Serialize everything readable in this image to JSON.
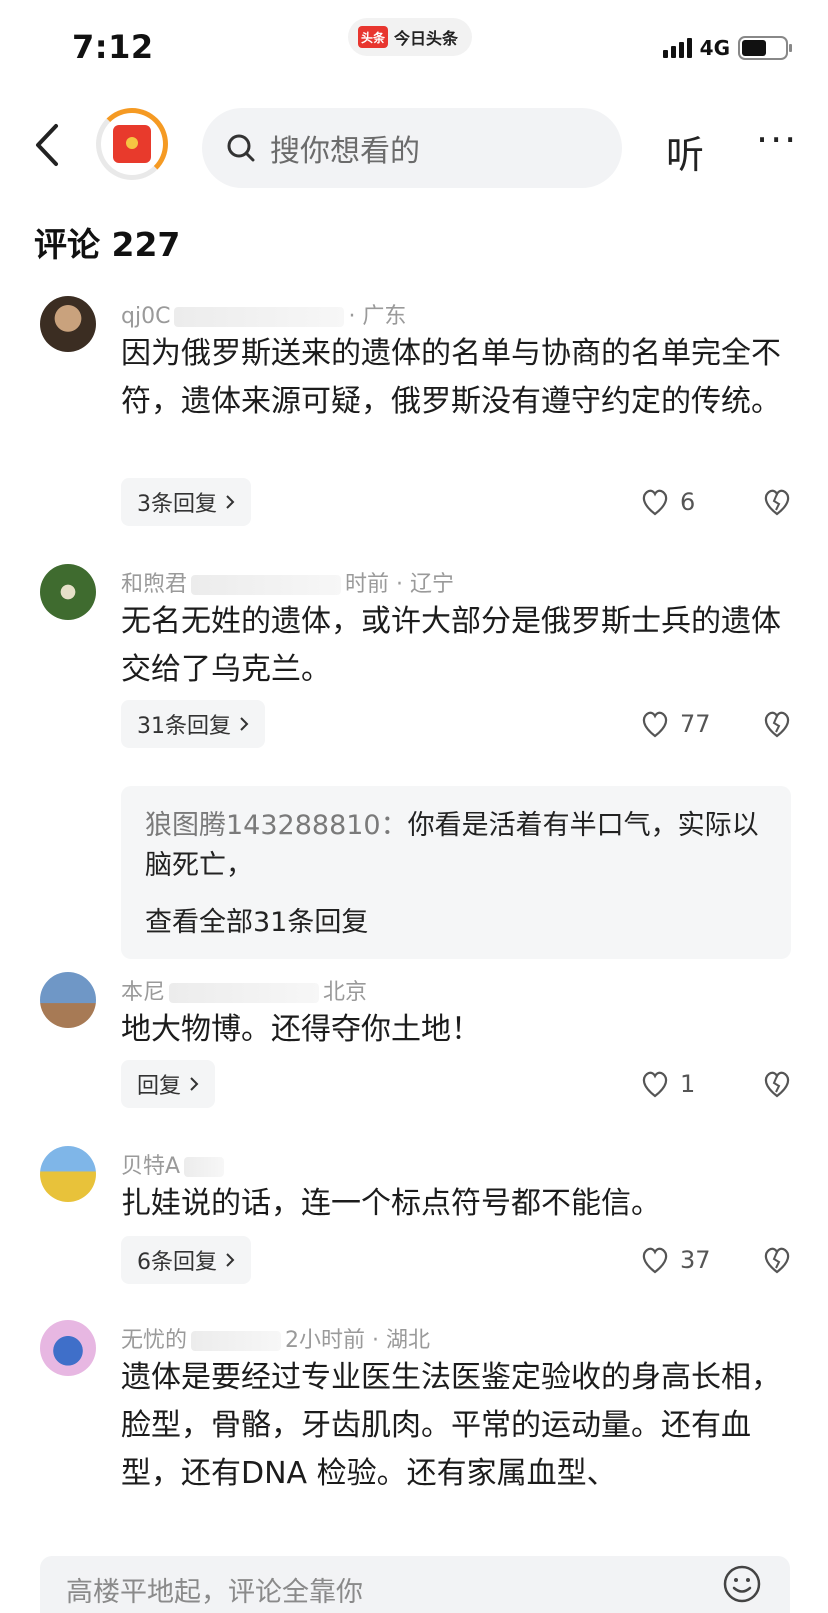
{
  "status_bar": {
    "time": "7:12",
    "app_badge": "头条",
    "app_name": "今日头条",
    "network": "4G"
  },
  "nav": {
    "search_placeholder": "搜你想看的",
    "listen_label": "听",
    "more_label": "···"
  },
  "comments_header": "评论 227",
  "comments": [
    {
      "user": "qj0C",
      "location": "· 广东",
      "text": "因为俄罗斯送来的遗体的名单与协商的名单完全不符，遗体来源可疑，俄罗斯没有遵守约定的传统。",
      "replies_label": "3条回复",
      "likes": "6"
    },
    {
      "user": "和煦君",
      "location": "时前 · 辽宁",
      "text": "无名无姓的遗体，或许大部分是俄罗斯士兵的遗体交给了乌克兰。",
      "replies_label": "31条回复",
      "likes": "77",
      "sub_reply": {
        "user": "狼图腾143288810：",
        "text": "你看是活着有半口气，实际以脑死亡，",
        "view_all": "查看全部31条回复"
      }
    },
    {
      "user": "本尼",
      "location": "北京",
      "text": "地大物博。还得夺你土地！",
      "replies_label": "回复",
      "likes": "1"
    },
    {
      "user": "贝特A",
      "location": "",
      "text": "扎娃说的话，连一个标点符号都不能信。",
      "replies_label": "6条回复",
      "likes": "37"
    },
    {
      "user": "无忧的",
      "location": "2小时前 · 湖北",
      "text": "遗体是要经过专业医生法医鉴定验收的身高长相，脸型，骨骼，牙齿肌肉。平常的运动量。还有血型，还有DNA 检验。还有家属血型、"
    }
  ],
  "bottom_input": {
    "placeholder": "高楼平地起，评论全靠你"
  },
  "colors": {
    "accent_red": "#e8362f",
    "ring_orange": "#f59a23",
    "meta_gray": "#9a9a9a"
  },
  "icons": [
    "back-arrow-icon",
    "red-packet-icon",
    "search-icon",
    "heart-icon",
    "broken-heart-icon",
    "emoji-icon",
    "chevron-right-icon"
  ]
}
